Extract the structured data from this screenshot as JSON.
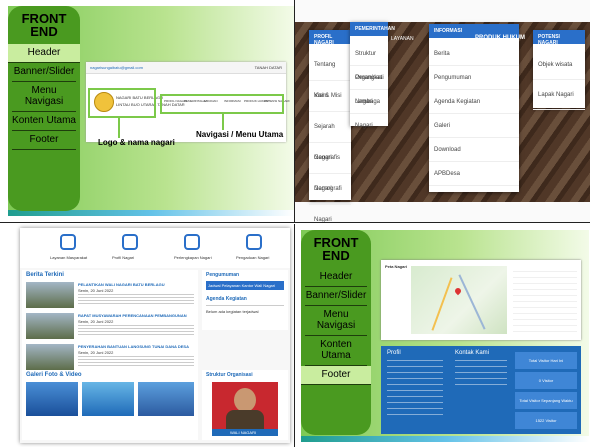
{
  "q1": {
    "nav": {
      "title": "FRONT\nEND",
      "items": [
        "Header",
        "Banner/Slider",
        "Menu Navigasi",
        "Konten Utama",
        "Footer"
      ],
      "active": 0
    },
    "mock": {
      "email": "nagarisungaibatu@gmail.com",
      "rightlink": "TANAH DATAR",
      "logo_lines": [
        "NAGARI BATU BERLAGU",
        "LINTAU BUO UTARA - TANAH DATAR"
      ],
      "nav_items": [
        "PROFIL NAGARI",
        "PEMERINTAHAN",
        "LAYANAN",
        "INFORMASI",
        "PRODUK HUKUM",
        "POTENSI NAGARI"
      ]
    },
    "labels": {
      "logo": "Logo & nama nagari",
      "nav": "Navigasi / Menu Utama"
    }
  },
  "q2": {
    "menus": [
      "PROFIL NAGARI",
      "PEMERINTAHAN",
      "LAYANAN",
      "INFORMASI",
      "PRODUK HUKUM",
      "POTENSI NAGARI"
    ],
    "profil": [
      "Tentang Kami",
      "Visi & Misi",
      "Sejarah Nagari",
      "Geografis Nagari",
      "Demografi Nagari"
    ],
    "pemerintahan": [
      "Struktur Organisasi",
      "Perangkat Nagari",
      "Lembaga Nagari"
    ],
    "informasi": [
      "Berita",
      "Pengumuman",
      "Agenda Kegiatan",
      "Galeri",
      "Download",
      "APBDesa"
    ],
    "potensi": [
      "Objek wisata",
      "Lapak Nagari"
    ]
  },
  "q3": {
    "icons": [
      {
        "label": "Layanan Masyarakat",
        "icon": "service-icon"
      },
      {
        "label": "Profil Nagari",
        "icon": "profile-icon"
      },
      {
        "label": "Perlengkapan Nagari",
        "icon": "equipment-icon"
      },
      {
        "label": "Pengaduan Nagari",
        "icon": "complaint-icon"
      }
    ],
    "berita_title": "Berita Terkini",
    "berita": [
      {
        "title": "PELANTIKAN WALI NAGARI BATU BERLAGU",
        "date": "Senin, 20 Juni 2022"
      },
      {
        "title": "RAPAT MUSYAWARAH PERENCANAAN PEMBANGUNAN",
        "date": "Senin, 20 Juni 2022"
      },
      {
        "title": "PENYERAHAN BANTUAN LANGSUNG TUNAI DANA DESA",
        "date": "Senin, 20 Juni 2022"
      }
    ],
    "pengumuman_title": "Pengumuman",
    "pengumuman_item": "Jadwal Pelayanan Kantor Wali Nagari",
    "agenda_title": "Agenda Kegiatan",
    "agenda_note": "Belum ada kegiatan terjadwal",
    "galeri_title": "Galeri Foto & Video",
    "struktur_title": "Struktur Organisasi",
    "struktur_role": "WALI NAGARI"
  },
  "q4": {
    "nav": {
      "title": "FRONT\nEND",
      "items": [
        "Header",
        "Banner/Slider",
        "Menu Navigasi",
        "Konten Utama",
        "Footer"
      ],
      "active": 4
    },
    "map_title": "Peta Nagari",
    "profil_heading": "Profil",
    "kontak_heading": "Kontak Kami",
    "btns": [
      "Total Visitor Hari Ini",
      "0 Visitor",
      "Total Visitor Sepanjang Waktu",
      "1522 Visitor"
    ]
  },
  "colors": {
    "sidenav": "#4a9a20",
    "slide_start": "#7ec955",
    "accent_blue": "#2a6fc9",
    "footer_blue": "#1f6ab8"
  }
}
